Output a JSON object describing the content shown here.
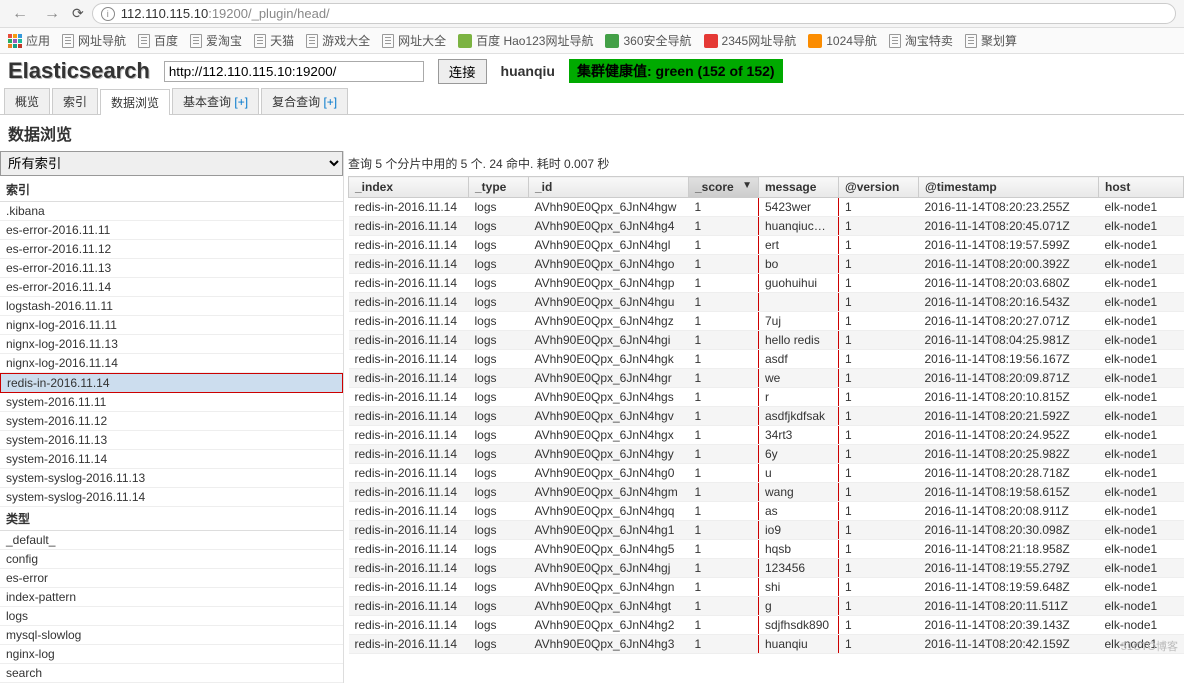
{
  "browser": {
    "url_prefix": "112.110.115.10",
    "url_port": ":19200",
    "url_path": "/_plugin/head/"
  },
  "bookmarks": [
    {
      "label": "应用",
      "type": "apps"
    },
    {
      "label": "网址导航",
      "type": "doc"
    },
    {
      "label": "百度",
      "type": "doc"
    },
    {
      "label": "爱淘宝",
      "type": "doc"
    },
    {
      "label": "天猫",
      "type": "doc"
    },
    {
      "label": "游戏大全",
      "type": "doc"
    },
    {
      "label": "网址大全",
      "type": "doc"
    },
    {
      "label": "百度 Hao123网址导航",
      "type": "hao"
    },
    {
      "label": "360安全导航",
      "type": "360"
    },
    {
      "label": "2345网址导航",
      "type": "2345"
    },
    {
      "label": "1024导航",
      "type": "1024"
    },
    {
      "label": "淘宝特卖",
      "type": "doc"
    },
    {
      "label": "聚划算",
      "type": "doc"
    }
  ],
  "es": {
    "logo": "Elasticsearch",
    "url": "http://112.110.115.10:19200/",
    "connect": "连接",
    "cluster": "huanqiu",
    "health": "集群健康值: green (152 of 152)"
  },
  "tabs": {
    "overview": "概览",
    "indices": "索引",
    "browser": "数据浏览",
    "structured": "基本查询",
    "any": "复合查询",
    "plus": "[+]"
  },
  "subtitle": "数据浏览",
  "sidebar": {
    "all_indices": "所有索引",
    "indices_heading": "索引",
    "indices": [
      ".kibana",
      "es-error-2016.11.11",
      "es-error-2016.11.12",
      "es-error-2016.11.13",
      "es-error-2016.11.14",
      "logstash-2016.11.11",
      "nignx-log-2016.11.11",
      "nignx-log-2016.11.13",
      "nignx-log-2016.11.14",
      "redis-in-2016.11.14",
      "system-2016.11.11",
      "system-2016.11.12",
      "system-2016.11.13",
      "system-2016.11.14",
      "system-syslog-2016.11.13",
      "system-syslog-2016.11.14"
    ],
    "selected_index": "redis-in-2016.11.14",
    "types_heading": "类型",
    "types": [
      "_default_",
      "config",
      "es-error",
      "index-pattern",
      "logs",
      "mysql-slowlog",
      "nginx-log",
      "search"
    ]
  },
  "query_status": "查询 5 个分片中用的 5 个. 24 命中. 耗时 0.007 秒",
  "columns": {
    "index": "_index",
    "type": "_type",
    "id": "_id",
    "score": "_score",
    "message": "message",
    "version": "@version",
    "timestamp": "@timestamp",
    "host": "host"
  },
  "rows": [
    {
      "index": "redis-in-2016.11.14",
      "type": "logs",
      "id": "AVhh90E0Qpx_6JnN4hgw",
      "score": "1",
      "message": "5423wer",
      "version": "1",
      "timestamp": "2016-11-14T08:20:23.255Z",
      "host": "elk-node1"
    },
    {
      "index": "redis-in-2016.11.14",
      "type": "logs",
      "id": "AVhh90E0Qpx_6JnN4hg4",
      "score": "1",
      "message": "huanqiuchain",
      "version": "1",
      "timestamp": "2016-11-14T08:20:45.071Z",
      "host": "elk-node1"
    },
    {
      "index": "redis-in-2016.11.14",
      "type": "logs",
      "id": "AVhh90E0Qpx_6JnN4hgl",
      "score": "1",
      "message": "ert",
      "version": "1",
      "timestamp": "2016-11-14T08:19:57.599Z",
      "host": "elk-node1"
    },
    {
      "index": "redis-in-2016.11.14",
      "type": "logs",
      "id": "AVhh90E0Qpx_6JnN4hgo",
      "score": "1",
      "message": "bo",
      "version": "1",
      "timestamp": "2016-11-14T08:20:00.392Z",
      "host": "elk-node1"
    },
    {
      "index": "redis-in-2016.11.14",
      "type": "logs",
      "id": "AVhh90E0Qpx_6JnN4hgp",
      "score": "1",
      "message": "guohuihui",
      "version": "1",
      "timestamp": "2016-11-14T08:20:03.680Z",
      "host": "elk-node1"
    },
    {
      "index": "redis-in-2016.11.14",
      "type": "logs",
      "id": "AVhh90E0Qpx_6JnN4hgu",
      "score": "1",
      "message": "",
      "version": "1",
      "timestamp": "2016-11-14T08:20:16.543Z",
      "host": "elk-node1"
    },
    {
      "index": "redis-in-2016.11.14",
      "type": "logs",
      "id": "AVhh90E0Qpx_6JnN4hgz",
      "score": "1",
      "message": "7uj",
      "version": "1",
      "timestamp": "2016-11-14T08:20:27.071Z",
      "host": "elk-node1"
    },
    {
      "index": "redis-in-2016.11.14",
      "type": "logs",
      "id": "AVhh90E0Qpx_6JnN4hgi",
      "score": "1",
      "message": "hello redis",
      "version": "1",
      "timestamp": "2016-11-14T08:04:25.981Z",
      "host": "elk-node1"
    },
    {
      "index": "redis-in-2016.11.14",
      "type": "logs",
      "id": "AVhh90E0Qpx_6JnN4hgk",
      "score": "1",
      "message": "asdf",
      "version": "1",
      "timestamp": "2016-11-14T08:19:56.167Z",
      "host": "elk-node1"
    },
    {
      "index": "redis-in-2016.11.14",
      "type": "logs",
      "id": "AVhh90E0Qpx_6JnN4hgr",
      "score": "1",
      "message": "we",
      "version": "1",
      "timestamp": "2016-11-14T08:20:09.871Z",
      "host": "elk-node1"
    },
    {
      "index": "redis-in-2016.11.14",
      "type": "logs",
      "id": "AVhh90E0Qpx_6JnN4hgs",
      "score": "1",
      "message": "r",
      "version": "1",
      "timestamp": "2016-11-14T08:20:10.815Z",
      "host": "elk-node1"
    },
    {
      "index": "redis-in-2016.11.14",
      "type": "logs",
      "id": "AVhh90E0Qpx_6JnN4hgv",
      "score": "1",
      "message": "asdfjkdfsak",
      "version": "1",
      "timestamp": "2016-11-14T08:20:21.592Z",
      "host": "elk-node1"
    },
    {
      "index": "redis-in-2016.11.14",
      "type": "logs",
      "id": "AVhh90E0Qpx_6JnN4hgx",
      "score": "1",
      "message": "34rt3",
      "version": "1",
      "timestamp": "2016-11-14T08:20:24.952Z",
      "host": "elk-node1"
    },
    {
      "index": "redis-in-2016.11.14",
      "type": "logs",
      "id": "AVhh90E0Qpx_6JnN4hgy",
      "score": "1",
      "message": "6y",
      "version": "1",
      "timestamp": "2016-11-14T08:20:25.982Z",
      "host": "elk-node1"
    },
    {
      "index": "redis-in-2016.11.14",
      "type": "logs",
      "id": "AVhh90E0Qpx_6JnN4hg0",
      "score": "1",
      "message": "u",
      "version": "1",
      "timestamp": "2016-11-14T08:20:28.718Z",
      "host": "elk-node1"
    },
    {
      "index": "redis-in-2016.11.14",
      "type": "logs",
      "id": "AVhh90E0Qpx_6JnN4hgm",
      "score": "1",
      "message": "wang",
      "version": "1",
      "timestamp": "2016-11-14T08:19:58.615Z",
      "host": "elk-node1"
    },
    {
      "index": "redis-in-2016.11.14",
      "type": "logs",
      "id": "AVhh90E0Qpx_6JnN4hgq",
      "score": "1",
      "message": "as",
      "version": "1",
      "timestamp": "2016-11-14T08:20:08.911Z",
      "host": "elk-node1"
    },
    {
      "index": "redis-in-2016.11.14",
      "type": "logs",
      "id": "AVhh90E0Qpx_6JnN4hg1",
      "score": "1",
      "message": "io9",
      "version": "1",
      "timestamp": "2016-11-14T08:20:30.098Z",
      "host": "elk-node1"
    },
    {
      "index": "redis-in-2016.11.14",
      "type": "logs",
      "id": "AVhh90E0Qpx_6JnN4hg5",
      "score": "1",
      "message": "hqsb",
      "version": "1",
      "timestamp": "2016-11-14T08:21:18.958Z",
      "host": "elk-node1"
    },
    {
      "index": "redis-in-2016.11.14",
      "type": "logs",
      "id": "AVhh90E0Qpx_6JnN4hgj",
      "score": "1",
      "message": "123456",
      "version": "1",
      "timestamp": "2016-11-14T08:19:55.279Z",
      "host": "elk-node1"
    },
    {
      "index": "redis-in-2016.11.14",
      "type": "logs",
      "id": "AVhh90E0Qpx_6JnN4hgn",
      "score": "1",
      "message": "shi",
      "version": "1",
      "timestamp": "2016-11-14T08:19:59.648Z",
      "host": "elk-node1"
    },
    {
      "index": "redis-in-2016.11.14",
      "type": "logs",
      "id": "AVhh90E0Qpx_6JnN4hgt",
      "score": "1",
      "message": "g",
      "version": "1",
      "timestamp": "2016-11-14T08:20:11.511Z",
      "host": "elk-node1"
    },
    {
      "index": "redis-in-2016.11.14",
      "type": "logs",
      "id": "AVhh90E0Qpx_6JnN4hg2",
      "score": "1",
      "message": "sdjfhsdk890",
      "version": "1",
      "timestamp": "2016-11-14T08:20:39.143Z",
      "host": "elk-node1"
    },
    {
      "index": "redis-in-2016.11.14",
      "type": "logs",
      "id": "AVhh90E0Qpx_6JnN4hg3",
      "score": "1",
      "message": "huanqiu",
      "version": "1",
      "timestamp": "2016-11-14T08:20:42.159Z",
      "host": "elk-node1"
    }
  ],
  "watermark": "51CTO博客"
}
